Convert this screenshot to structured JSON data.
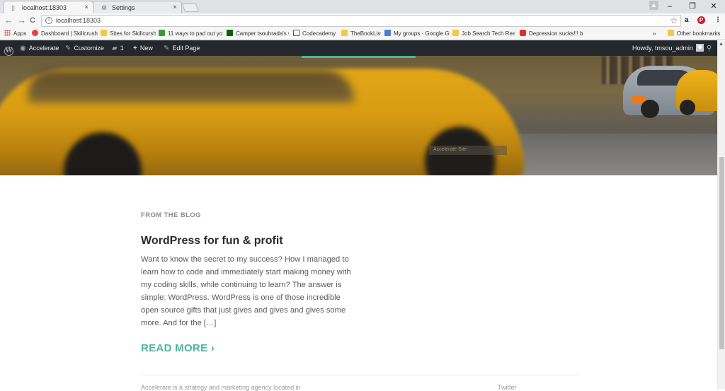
{
  "browser": {
    "tabs": [
      {
        "title": "localhost:18303",
        "icon": "page-icon"
      },
      {
        "title": "Settings",
        "icon": "gear-icon"
      }
    ],
    "address": "localhost:18303",
    "nav": {
      "back": "←",
      "forward": "→",
      "reload": "C"
    },
    "window": {
      "minimize": "–",
      "restore": "❐",
      "close": "✕"
    },
    "profile_glyph": "▲",
    "bookmarks": [
      {
        "label": "Apps",
        "icon": "apps-grid-icon",
        "color": "#e0452b"
      },
      {
        "label": "Dashboard | Skillcrush",
        "icon": "skillcrush-icon",
        "color": "#e5423b"
      },
      {
        "label": "Sites for Skillcursh",
        "icon": "folder-icon",
        "color": "#f5c842"
      },
      {
        "label": "11 ways to pad out yo",
        "icon": "bookmark-icon",
        "color": "#3a9b3a"
      },
      {
        "label": "Camper tsouhrada's C",
        "icon": "freecodecamp-icon",
        "color": "#006400"
      },
      {
        "label": "Codecademy",
        "icon": "codecademy-icon",
        "color": "#ffffff"
      },
      {
        "label": "TheBookList",
        "icon": "folder-icon",
        "color": "#f5c842"
      },
      {
        "label": "My groups - Google G",
        "icon": "google-groups-icon",
        "color": "#4a7fd6"
      },
      {
        "label": "Job Search Tech Read",
        "icon": "folder-icon",
        "color": "#f5c842"
      },
      {
        "label": "Depression sucks!!! b",
        "icon": "youtube-icon",
        "color": "#e52d27"
      },
      {
        "label": "»",
        "icon": "",
        "color": ""
      },
      {
        "label": "Other bookmarks",
        "icon": "folder-icon",
        "color": "#f5c842"
      }
    ]
  },
  "wp_admin_bar": {
    "logo": "W",
    "site": "Accelerate",
    "customize": "Customize",
    "comments_count": "1",
    "new": "New",
    "edit_page": "Edit Page",
    "howdy": "Howdy, tmsou_admin"
  },
  "hero": {
    "accent_color": "#4fb4a0",
    "caption": "Accelerate Site"
  },
  "blog": {
    "kicker": "FROM THE BLOG",
    "title": "WordPress for fun & profit",
    "excerpt": "Want to know the secret to my success? How I managed to learn how to code and immediately start making money with my coding skills, while continuing to learn? The answer is simple: WordPress. WordPress is one of those incredible open source gifts that just gives and gives and gives some more. And for the […]",
    "read_more": "READ MORE ›",
    "footer_left": "Accelerate is a strategy and marketing agency located in",
    "footer_right": "Twitter"
  }
}
